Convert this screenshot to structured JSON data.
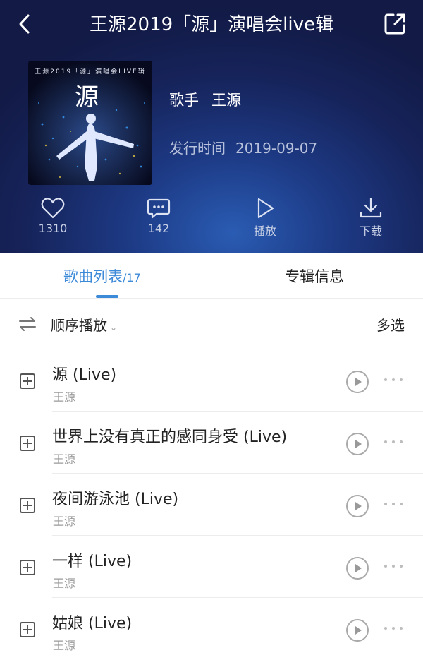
{
  "header": {
    "title": "王源2019「源」演唱会live辑"
  },
  "album": {
    "cover_caption": "王源2019「源」演唱会LIVE辑",
    "cover_glyph": "源",
    "artist_label": "歌手",
    "artist": "王源",
    "date_label": "发行时间",
    "date": "2019-09-07"
  },
  "actions": [
    {
      "icon": "heart-icon",
      "label": "1310"
    },
    {
      "icon": "comment-icon",
      "label": "142"
    },
    {
      "icon": "play-icon",
      "label": "播放"
    },
    {
      "icon": "download-icon",
      "label": "下载"
    }
  ],
  "tabs": {
    "songs_label": "歌曲列表",
    "songs_count": "/17",
    "info_label": "专辑信息"
  },
  "playbar": {
    "mode": "顺序播放",
    "multi": "多选"
  },
  "songs": [
    {
      "title": "源 (Live)",
      "artist": "王源"
    },
    {
      "title": "世界上没有真正的感同身受 (Live)",
      "artist": "王源"
    },
    {
      "title": "夜间游泳池 (Live)",
      "artist": "王源"
    },
    {
      "title": "一样 (Live)",
      "artist": "王源"
    },
    {
      "title": "姑娘 (Live)",
      "artist": "王源"
    }
  ],
  "colors": {
    "accent": "#3d8ad8",
    "hero_dark": "#121a45",
    "hero_light": "#2a5cb3"
  }
}
